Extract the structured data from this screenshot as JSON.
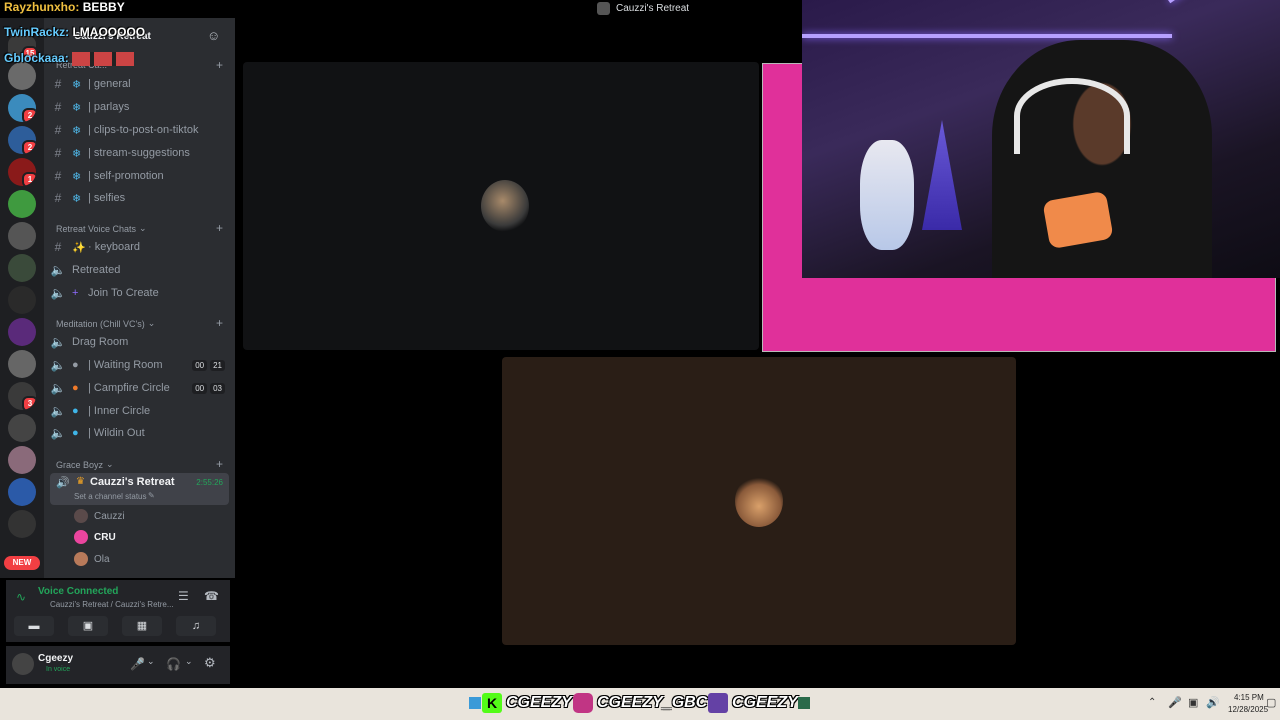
{
  "window": {
    "title": "Cauzzi's Retreat"
  },
  "chat_overlay": [
    {
      "user": "Rayzhunxho:",
      "message": "BEBBY",
      "color": "#f0c040"
    },
    {
      "user": "TwinRackz:",
      "message": "LMAOOOOO",
      "color": "#66ccff"
    },
    {
      "user": "Gblockaaa:",
      "message": "",
      "color": "#66ccff"
    }
  ],
  "server": {
    "name": "Cauzzi's Retreat",
    "partial_category": "Retreat Ca..."
  },
  "rail_badges": [
    "15",
    "2",
    "2",
    "1",
    "3"
  ],
  "rail_new_label": "NEW",
  "text_channels": [
    {
      "name": "| general"
    },
    {
      "name": "| parlays"
    },
    {
      "name": "| clips-to-post-on-tiktok"
    },
    {
      "name": "| stream-suggestions"
    },
    {
      "name": "| self-promotion"
    },
    {
      "name": "| selfies"
    }
  ],
  "categories": {
    "voice_chats": "Retreat Voice Chats",
    "meditation": "Meditation (Chill VC's)",
    "grace": "Grace Boyz"
  },
  "voice_chats": [
    {
      "name": "· keyboard"
    },
    {
      "name": "Retreated"
    },
    {
      "name": "Join To Create"
    }
  ],
  "meditation": [
    {
      "name": "Drag Room",
      "counts": []
    },
    {
      "name": "| Waiting Room",
      "counts": [
        "00",
        "21"
      ]
    },
    {
      "name": "| Campfire Circle",
      "counts": [
        "00",
        "03"
      ]
    },
    {
      "name": "| Inner Circle",
      "counts": []
    },
    {
      "name": "| Wildin Out",
      "counts": []
    }
  ],
  "active_channel": {
    "name": "Cauzzi's Retreat",
    "timer": "2:55:26",
    "status": "Set a channel status",
    "members": [
      "Cauzzi",
      "CRU",
      "Ola"
    ]
  },
  "voice_connected": {
    "status": "Voice Connected",
    "location": "Cauzzi's Retreat / Cauzzi's Retre..."
  },
  "user": {
    "name": "Cgeezy",
    "status": "In voice"
  },
  "taskbar": {
    "socials": [
      "CGEEZY",
      "CGEEZY_GBC",
      "CGEEZY"
    ],
    "time": "4:15 PM",
    "date": "12/28/2025"
  },
  "colors": {
    "accent_green": "#23a55a",
    "pink": "#e0309a",
    "badge_red": "#f23f43",
    "timer_green": "#23a55a"
  }
}
